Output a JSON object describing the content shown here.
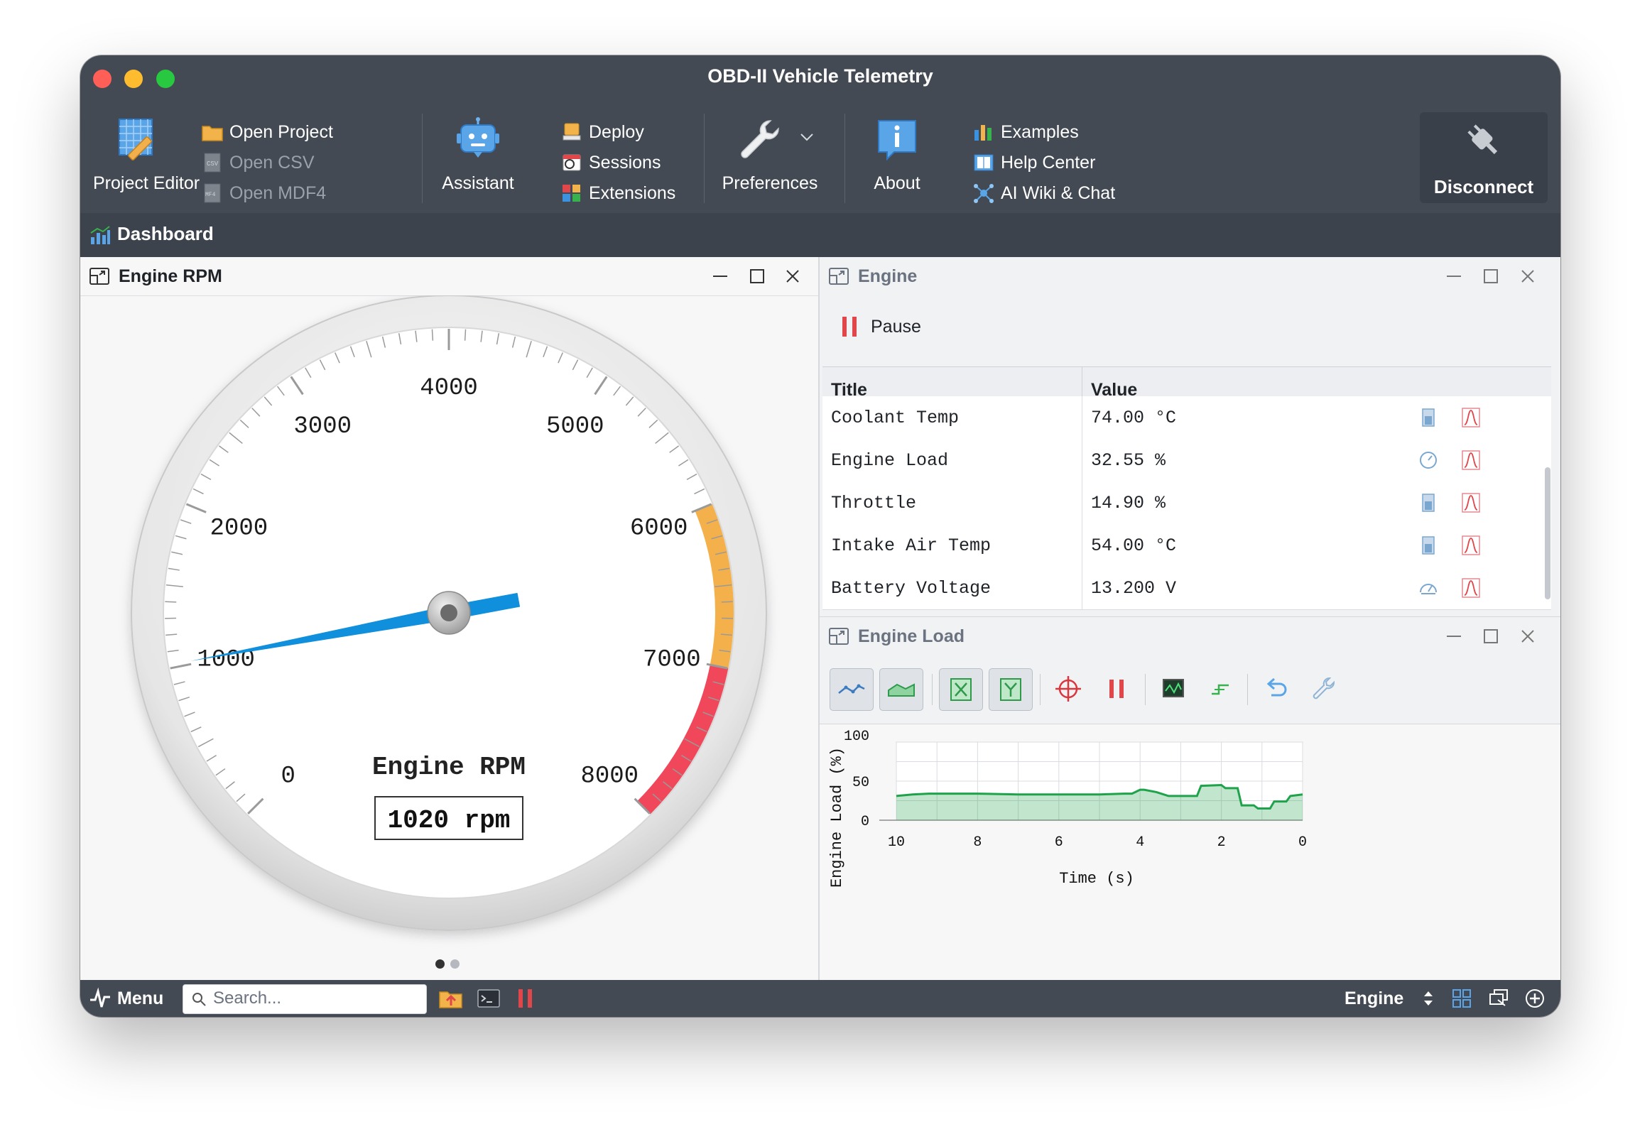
{
  "window": {
    "title": "OBD-II Vehicle Telemetry"
  },
  "toolbar": {
    "project_editor": "Project Editor",
    "open_project": "Open Project",
    "open_csv": "Open CSV",
    "open_mdf4": "Open MDF4",
    "assistant": "Assistant",
    "deploy": "Deploy",
    "sessions": "Sessions",
    "extensions": "Extensions",
    "preferences": "Preferences",
    "about": "About",
    "examples": "Examples",
    "help_center": "Help Center",
    "ai_wiki": "AI Wiki & Chat",
    "disconnect": "Disconnect"
  },
  "dashboard": {
    "label": "Dashboard"
  },
  "gauge_pane": {
    "title": "Engine RPM",
    "gauge_label": "Engine RPM",
    "readout": "1020 rpm",
    "tick_labels": [
      "0",
      "1000",
      "2000",
      "3000",
      "4000",
      "5000",
      "6000",
      "7000",
      "8000"
    ],
    "value": 1020,
    "min": 0,
    "max": 8000,
    "warning_from": 6000,
    "danger_from": 7000,
    "colors": {
      "needle": "#0f8fdc",
      "warning": "#f4b04a",
      "danger": "#f0475a"
    },
    "pages": 2,
    "active_page": 0
  },
  "engine_pane": {
    "title": "Engine",
    "pause_label": "Pause",
    "columns": [
      "Title",
      "Value"
    ],
    "rows": [
      {
        "title": "Coolant Temp",
        "value": "74.00 °C",
        "icon": "bar-icon"
      },
      {
        "title": "Engine Load",
        "value": "32.55 %",
        "icon": "gauge-icon"
      },
      {
        "title": "Throttle",
        "value": "14.90 %",
        "icon": "bar-icon"
      },
      {
        "title": "Intake Air Temp",
        "value": "54.00 °C",
        "icon": "bar-icon"
      },
      {
        "title": "Battery Voltage",
        "value": "13.200 V",
        "icon": "meter-icon"
      }
    ]
  },
  "load_pane": {
    "title": "Engine Load",
    "chart_data": {
      "type": "area",
      "xlabel": "Time (s)",
      "ylabel": "Engine Load (%)",
      "xlim": [
        10,
        0
      ],
      "ylim": [
        0,
        100
      ],
      "x_ticks": [
        "10",
        "8",
        "6",
        "4",
        "2",
        "0"
      ],
      "y_ticks": [
        "100",
        "50",
        "0"
      ],
      "grid": true,
      "color": "#1fa34a",
      "x": [
        10.0,
        9.6,
        9.2,
        8.8,
        8.0,
        7.0,
        6.0,
        5.0,
        4.4,
        4.2,
        4.0,
        3.9,
        3.6,
        3.3,
        3.0,
        2.6,
        2.5,
        2.0,
        1.9,
        1.6,
        1.5,
        1.2,
        1.1,
        0.8,
        0.7,
        0.4,
        0.3,
        0.0
      ],
      "y": [
        31,
        33,
        34,
        34,
        34,
        33,
        33,
        33,
        34,
        34,
        39,
        39,
        36,
        31,
        31,
        31,
        44,
        45,
        41,
        41,
        19,
        19,
        15,
        15,
        24,
        24,
        31,
        33
      ]
    }
  },
  "bottombar": {
    "menu": "Menu",
    "search_placeholder": "Search...",
    "workspace": "Engine"
  }
}
